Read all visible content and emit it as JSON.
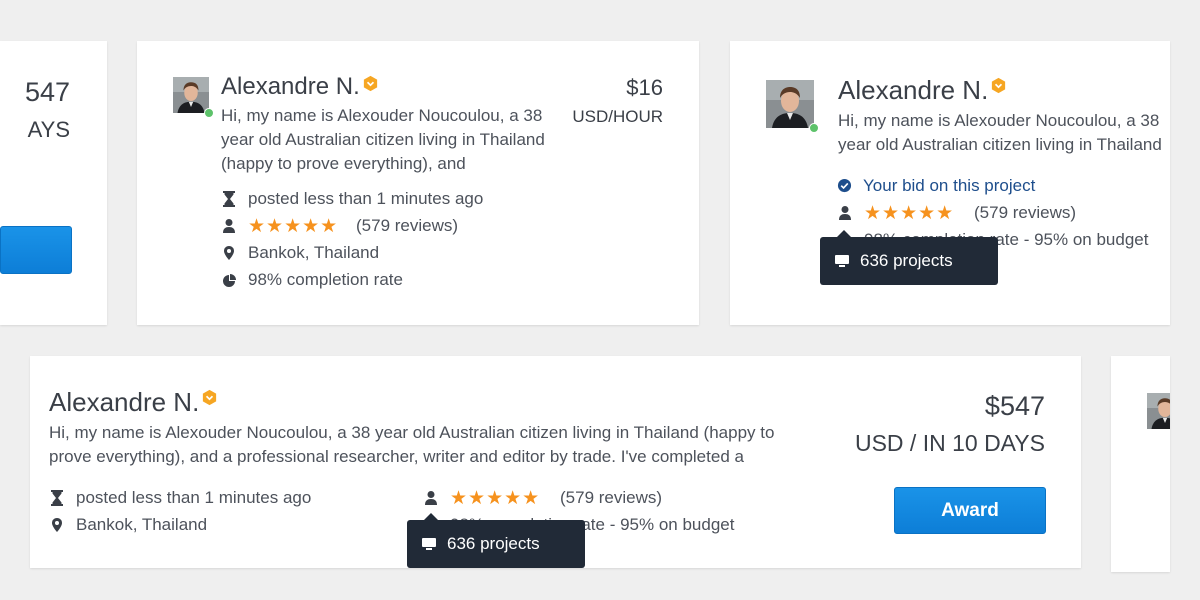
{
  "colors": {
    "accent": "#f6921e",
    "primary_button": "#1288e0",
    "tooltip_bg": "#212a37",
    "online": "#5dc26a",
    "bid_link": "#1e4e8c"
  },
  "left_partial": {
    "price": "547",
    "unit": "AYS"
  },
  "card1": {
    "name": "Alexandre N.",
    "bio": "Hi, my name is Alexouder Noucoulou, a 38 year old Australian citizen living in Thailand (happy to prove everything), and",
    "price": "$16",
    "unit": "USD/HOUR",
    "posted": "posted less than 1 minutes ago",
    "reviews": "(579 reviews)",
    "location": "Bankok, Thailand",
    "completion": "98% completion rate",
    "rating": 5
  },
  "card2": {
    "name": "Alexandre N.",
    "bio": "Hi, my name is Alexouder Noucoulou, a 38 year old Australian citizen living in Thailand (happy to prove everything), and a professional researcher",
    "bid_label": "Your bid on this project",
    "reviews": "(579 reviews)",
    "completion_budget": "98% completion rate - 95% on budget",
    "tooltip": "636 projects",
    "rating": 5
  },
  "card3": {
    "name": "Alexandre N.",
    "bio": "Hi, my name is Alexouder Noucoulou, a 38 year old Australian citizen living in Thailand (happy to prove everything), and a professional researcher, writer and editor by trade. I've completed a",
    "price": "$547",
    "unit": "USD / IN 10 DAYS",
    "award_label": "Award",
    "posted": "posted less than 1 minutes ago",
    "location": "Bankok, Thailand",
    "reviews": "(579 reviews)",
    "completion_budget": "98% completion rate - 95% on budget",
    "tooltip": "636 projects",
    "rating": 5
  }
}
